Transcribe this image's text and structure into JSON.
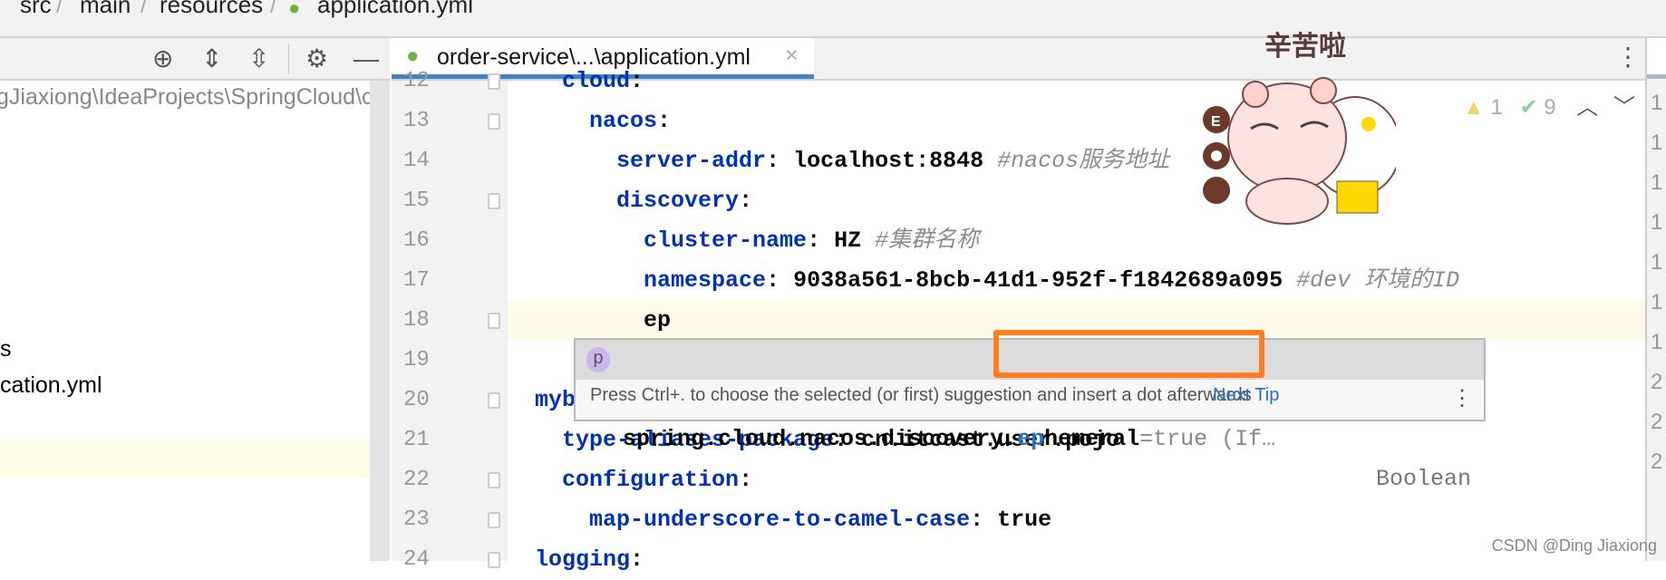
{
  "breadcrumb": [
    "src",
    "main",
    "resources",
    "application.yml"
  ],
  "left_panel": {
    "path": "gJiaxiong\\IdeaProjects\\SpringCloud\\cl",
    "items": [
      "s",
      "cation.yml"
    ]
  },
  "toolbar": {
    "icons": [
      "locate-icon",
      "expand-all-icon",
      "collapse-all-icon",
      "gear-icon",
      "minimize-icon"
    ]
  },
  "tab": {
    "label": "order-service\\...\\application.yml",
    "close": "×"
  },
  "inspections": {
    "warnings": "1",
    "typos": "9"
  },
  "editor": {
    "lines": [
      {
        "n": "12",
        "key": "cloud",
        "rest": ":",
        "indent": 1
      },
      {
        "n": "13",
        "key": "nacos",
        "rest": ":",
        "indent": 2
      },
      {
        "n": "14",
        "key": "server-addr",
        "rest": ": ",
        "val": "localhost:8848 ",
        "comment": "#nacos服务地址",
        "indent": 3
      },
      {
        "n": "15",
        "key": "discovery",
        "rest": ":",
        "indent": 3
      },
      {
        "n": "16",
        "key": "cluster-name",
        "rest": ": ",
        "val": "HZ ",
        "comment": "#集群名称",
        "indent": 4
      },
      {
        "n": "17",
        "key": "namespace",
        "rest": ": ",
        "val": "9038a561-8bcb-41d1-952f-f1842689a095 ",
        "comment": "#dev 环境的ID",
        "indent": 4
      },
      {
        "n": "18",
        "key": "",
        "rest": "",
        "val": "ep",
        "indent": 4
      },
      {
        "n": "19",
        "key": "",
        "rest": "",
        "indent": 0
      },
      {
        "n": "20",
        "key": "mybatis",
        "rest": ":",
        "indent": 0
      },
      {
        "n": "21",
        "key": "type-aliases-package",
        "rest": ": ",
        "val": "cn.itcast.user.pojo",
        "indent": 1
      },
      {
        "n": "22",
        "key": "configuration",
        "rest": ":",
        "indent": 1
      },
      {
        "n": "23",
        "key": "map-underscore-to-camel-case",
        "rest": ": ",
        "val": "true",
        "indent": 2
      },
      {
        "n": "24",
        "key": "logging",
        "rest": ":",
        "indent": 0
      }
    ]
  },
  "popup": {
    "badge": "p",
    "prefix": "spring.cloud.nacos.discove",
    "mid": "ry.",
    "match": "ep",
    "suffix": "hemeral",
    "default": "=true",
    "desc": " (If…",
    "type": "Boolean",
    "tip": "Press Ctrl+. to choose the selected (or first) suggestion and insert a dot afterwards",
    "next_tip": "Next Tip"
  },
  "sticker": {
    "text": "辛苦啦"
  },
  "right_strip": {
    "numbers": [
      "1",
      "1",
      "1",
      "1",
      "1",
      "1",
      "1",
      "2",
      "2",
      "2"
    ]
  },
  "watermark": "CSDN @Ding Jiaxiong"
}
